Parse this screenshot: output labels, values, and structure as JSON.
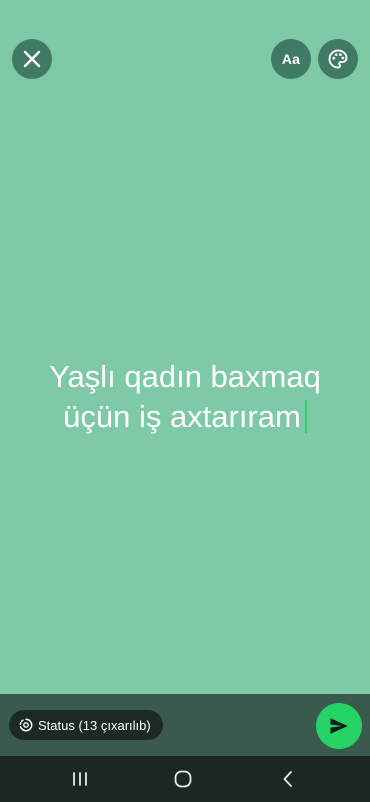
{
  "header": {
    "close_icon": "close-icon",
    "font_button_label": "Aa",
    "palette_icon": "palette-icon"
  },
  "status": {
    "text_line1": "Yaşlı qadın baxmaq",
    "text_line2": "üçün iş axtarıram",
    "background_color": "#7ecaa6",
    "caret_color": "#25d366"
  },
  "footer": {
    "audience_label": "Status (13 çıxarılıb)",
    "audience_icon": "status-icon",
    "send_icon": "send-icon",
    "send_color": "#25d366"
  },
  "navigation": {
    "recents_icon": "recents-icon",
    "home_icon": "home-icon",
    "back_icon": "back-icon"
  }
}
